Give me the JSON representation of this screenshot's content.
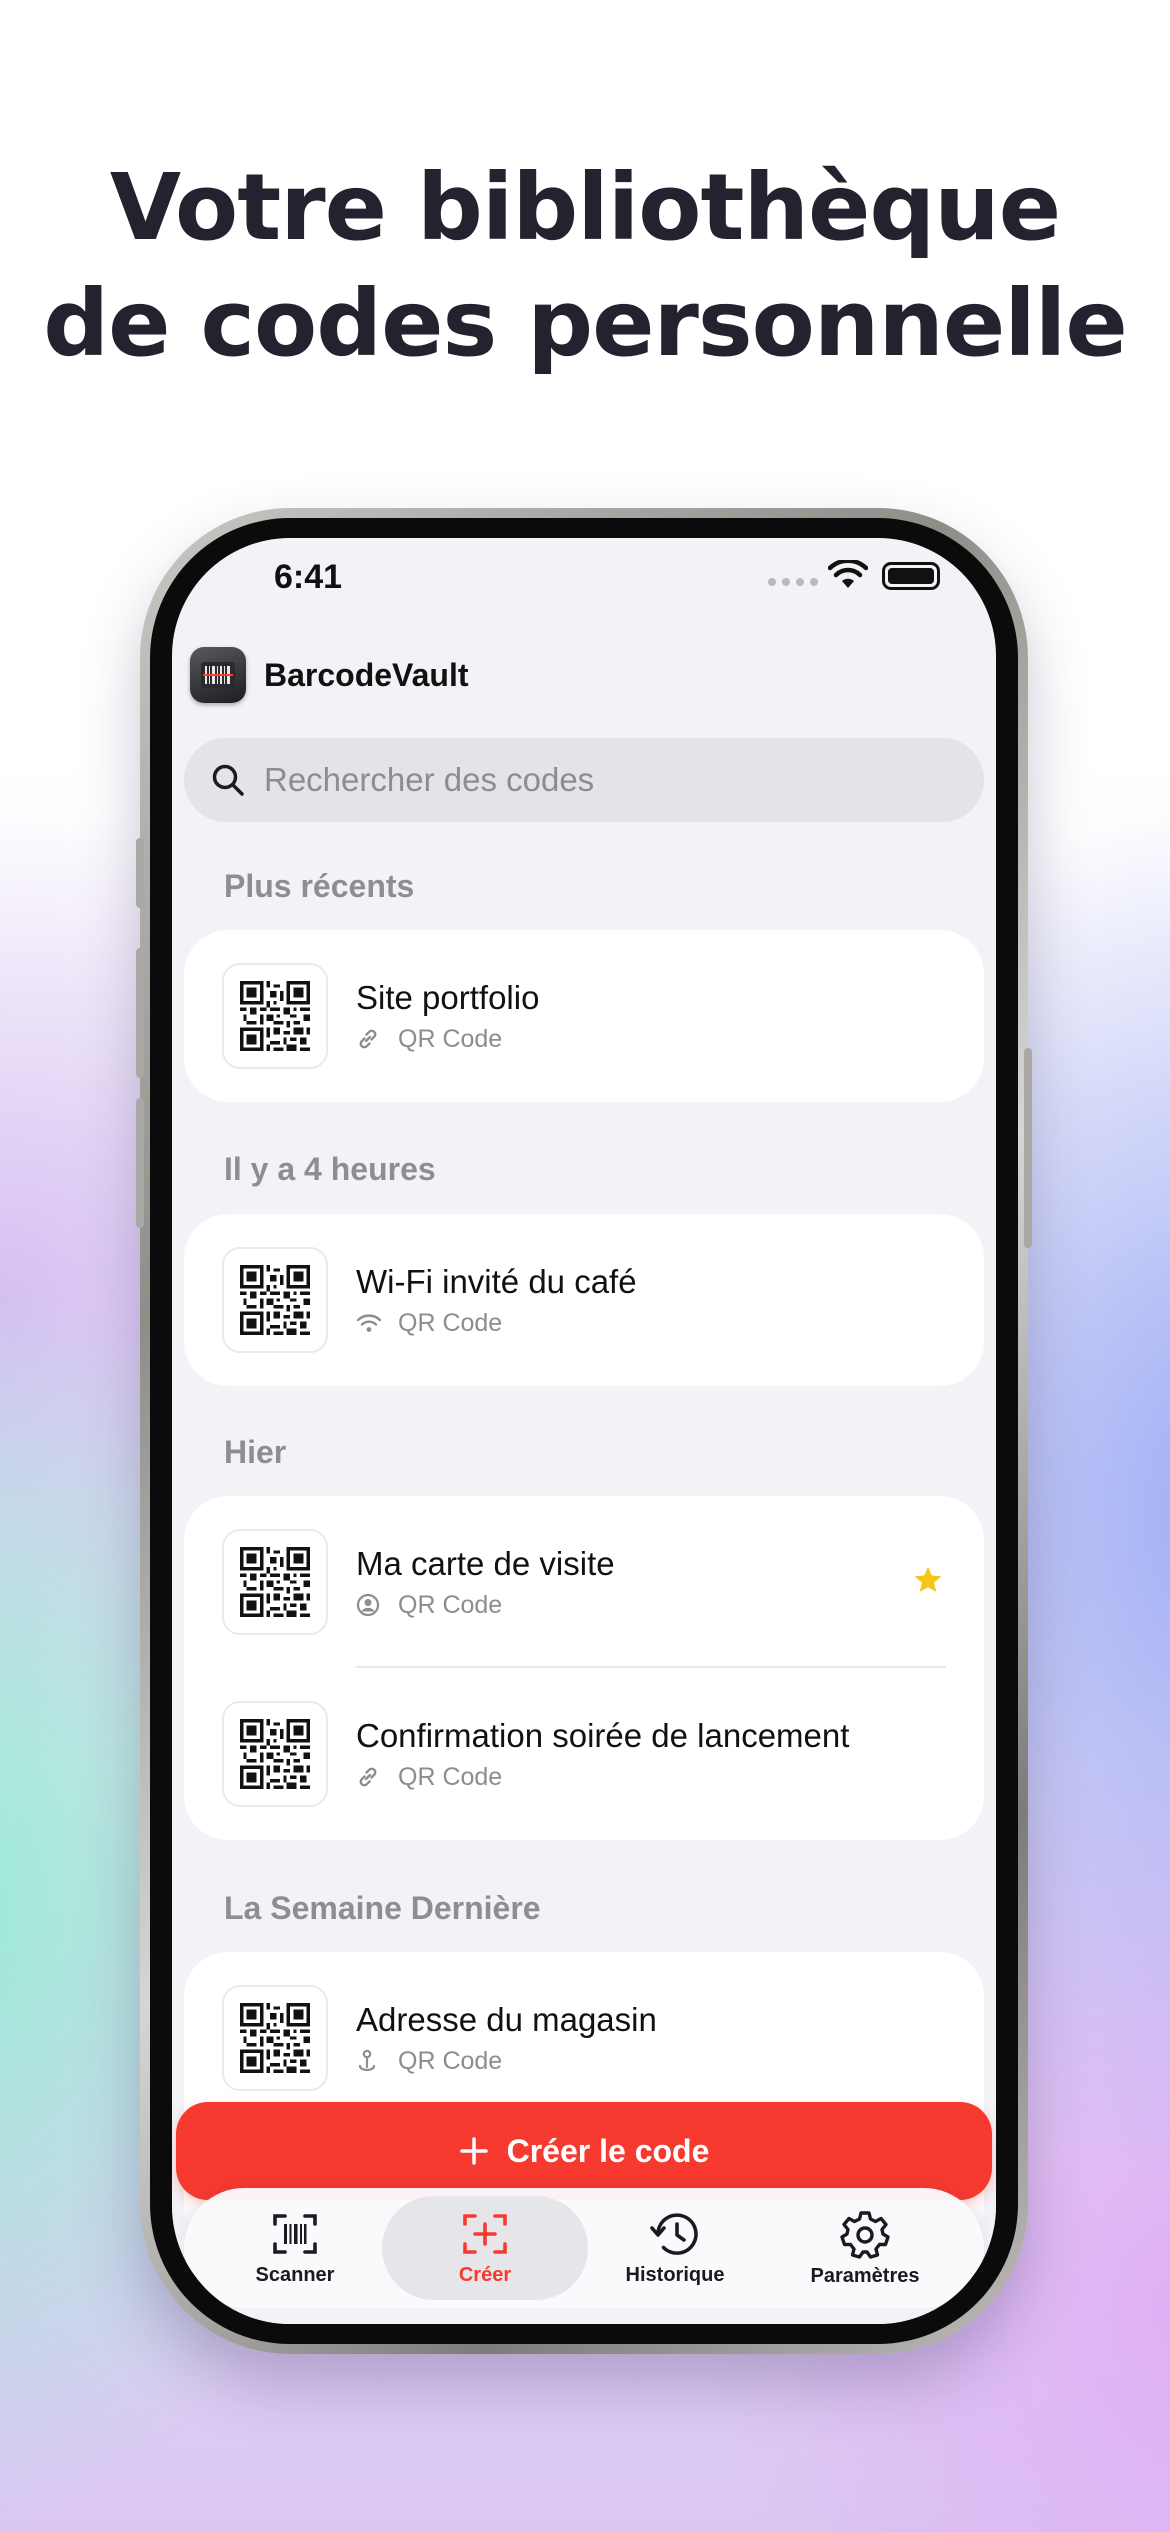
{
  "headline": {
    "line1": "Votre bibliothèque",
    "line2": "de codes personnelle"
  },
  "status_bar": {
    "time": "6:41"
  },
  "app": {
    "name": "BarcodeVault",
    "icon": "barcode-app-icon"
  },
  "search": {
    "placeholder": "Rechercher des codes",
    "icon": "search-icon"
  },
  "sections": [
    {
      "label": "Plus récents",
      "items": [
        {
          "title": "Site portfolio",
          "type": "QR Code",
          "type_icon": "link-icon",
          "favorite": false
        }
      ]
    },
    {
      "label": "Il y a 4 heures",
      "items": [
        {
          "title": "Wi-Fi invité du café",
          "type": "QR Code",
          "type_icon": "wifi-icon",
          "favorite": false
        }
      ]
    },
    {
      "label": "Hier",
      "items": [
        {
          "title": "Ma carte de visite",
          "type": "QR Code",
          "type_icon": "contact-icon",
          "favorite": true
        },
        {
          "title": "Confirmation soirée de lancement",
          "type": "QR Code",
          "type_icon": "link-icon",
          "favorite": false
        }
      ]
    },
    {
      "label": "La Semaine Dernière",
      "items": [
        {
          "title": "Adresse du magasin",
          "type": "QR Code",
          "type_icon": "location-icon",
          "favorite": false
        }
      ]
    }
  ],
  "cta": {
    "label": "Créer le code",
    "icon": "plus-icon"
  },
  "tabbar": {
    "tabs": [
      {
        "label": "Scanner",
        "icon": "barcode-scan-icon",
        "active": false
      },
      {
        "label": "Créer",
        "icon": "create-code-icon",
        "active": true
      },
      {
        "label": "Historique",
        "icon": "history-icon",
        "active": false
      },
      {
        "label": "Paramètres",
        "icon": "gear-icon",
        "active": false
      }
    ]
  },
  "colors": {
    "accent": "#f63a30",
    "favorite_star": "#f5c518",
    "headline": "#23222e",
    "secondary_text": "#8c8c92",
    "screen_background": "#f2f2f7"
  }
}
